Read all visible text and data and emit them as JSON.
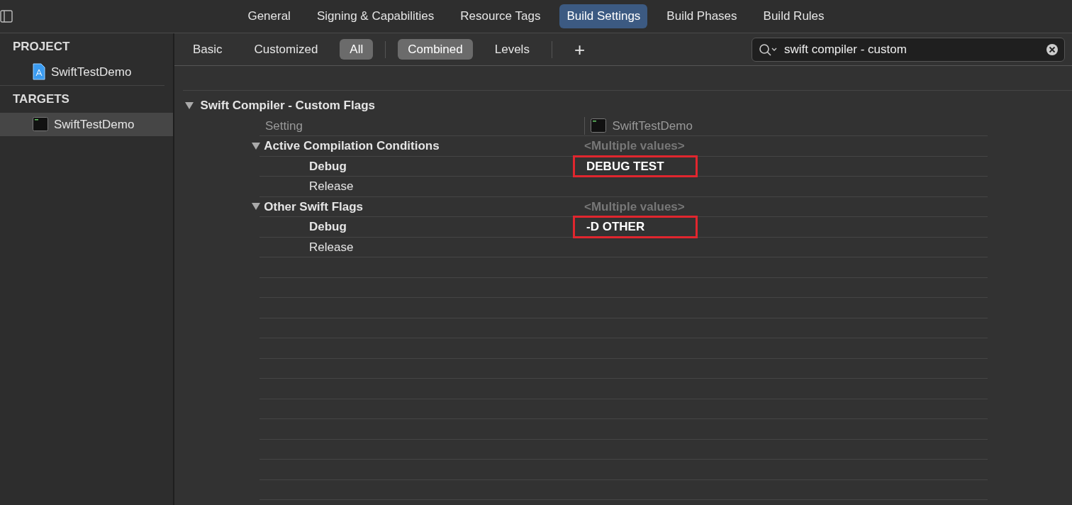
{
  "tabs": [
    {
      "label": "General",
      "selected": false
    },
    {
      "label": "Signing & Capabilities",
      "selected": false
    },
    {
      "label": "Resource Tags",
      "selected": false
    },
    {
      "label": "Build Settings",
      "selected": true
    },
    {
      "label": "Build Phases",
      "selected": false
    },
    {
      "label": "Build Rules",
      "selected": false
    }
  ],
  "sidebar": [
    {
      "title": "PROJECT",
      "items": [
        {
          "label": "SwiftTestDemo",
          "kind": "project",
          "selected": false
        }
      ]
    },
    {
      "title": "TARGETS",
      "items": [
        {
          "label": "SwiftTestDemo",
          "kind": "target",
          "selected": true
        }
      ]
    }
  ],
  "filter_groups": [
    [
      {
        "label": "Basic",
        "selected": false
      },
      {
        "label": "Customized",
        "selected": false
      },
      {
        "label": "All",
        "selected": true
      }
    ],
    [
      {
        "label": "Combined",
        "selected": true
      },
      {
        "label": "Levels",
        "selected": false
      }
    ]
  ],
  "add_button": "+",
  "search": {
    "value": "swift compiler - custom"
  },
  "section": {
    "title": "Swift Compiler - Custom Flags",
    "expanded": true,
    "column_setting": "Setting",
    "column_target": "SwiftTestDemo",
    "settings": [
      {
        "name": "Active Compilation Conditions",
        "expanded": true,
        "value": "<Multiple values>",
        "children": [
          {
            "name": "Debug",
            "value": "DEBUG TEST",
            "customized": true,
            "highlighted": true
          },
          {
            "name": "Release",
            "customized": false
          }
        ]
      },
      {
        "name": "Other Swift Flags",
        "expanded": true,
        "value": "<Multiple values>",
        "children": [
          {
            "name": "Debug",
            "value": "-D OTHER",
            "customized": true,
            "highlighted": true
          },
          {
            "name": "Release",
            "customized": false
          }
        ]
      }
    ]
  }
}
